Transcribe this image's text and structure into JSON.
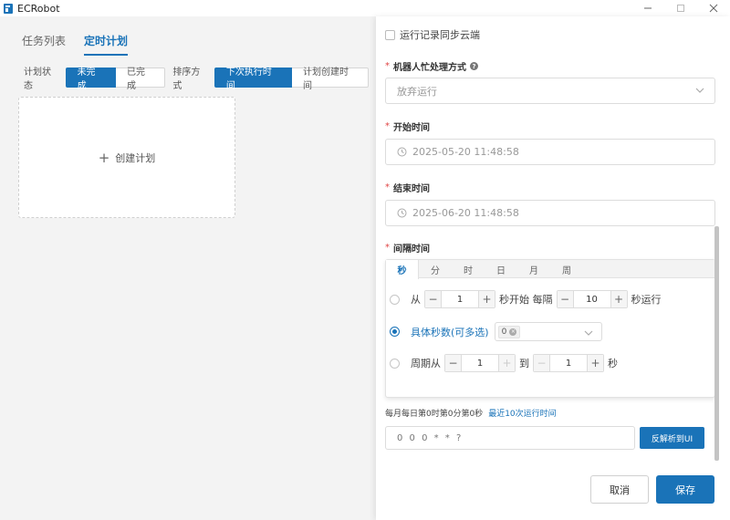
{
  "window": {
    "title": "ECRobot",
    "logo_icon": "ecrobot-logo",
    "controls": [
      "minimize-icon",
      "maximize-icon",
      "close-icon"
    ]
  },
  "left": {
    "tabs": [
      {
        "label": "任务列表",
        "active": false
      },
      {
        "label": "定时计划",
        "active": true
      }
    ],
    "status_filter": {
      "label": "计划状态",
      "options": [
        "未完成",
        "已完成"
      ],
      "selected": "未完成"
    },
    "sort_filter": {
      "label": "排序方式",
      "options": [
        "下次执行时间",
        "计划创建时间"
      ],
      "selected": "下次执行时间"
    },
    "create_card": {
      "label": "创建计划",
      "icon": "plus-icon"
    }
  },
  "form": {
    "sync_checkbox": {
      "label": "运行记录同步云端",
      "checked": false
    },
    "busy_mode": {
      "label": "机器人忙处理方式",
      "required": true,
      "help_icon": "question-icon",
      "value": "放弃运行"
    },
    "start_time": {
      "label": "开始时间",
      "required": true,
      "value": "2025-05-20 11:48:58"
    },
    "end_time": {
      "label": "结束时间",
      "required": true,
      "value": "2025-06-20 11:48:58"
    },
    "interval": {
      "label": "间隔时间",
      "required": true,
      "tabs": [
        "秒",
        "分",
        "时",
        "日",
        "月",
        "周"
      ],
      "active_tab": "秒",
      "options": {
        "from": {
          "prefix": "从",
          "start_value": "1",
          "mid_text": "秒开始 每隔",
          "every_value": "10",
          "suffix": "秒运行",
          "selected": false
        },
        "specific": {
          "label": "具体秒数(可多选)",
          "tag": "0",
          "selected": true
        },
        "cycle": {
          "prefix": "周期从",
          "from_value": "1",
          "to_text": "到",
          "to_value": "1",
          "suffix": "秒",
          "selected": false
        }
      }
    },
    "cron_hint": "每月每日第0时第0分第0秒",
    "cron_link": "最近10次运行时间",
    "cron_value": "0 0 0 * * ?",
    "parse_button": "反解析到UI",
    "cancel_button": "取消",
    "save_button": "保存"
  },
  "colors": {
    "accent": "#1a73b8",
    "required": "#e04545"
  }
}
